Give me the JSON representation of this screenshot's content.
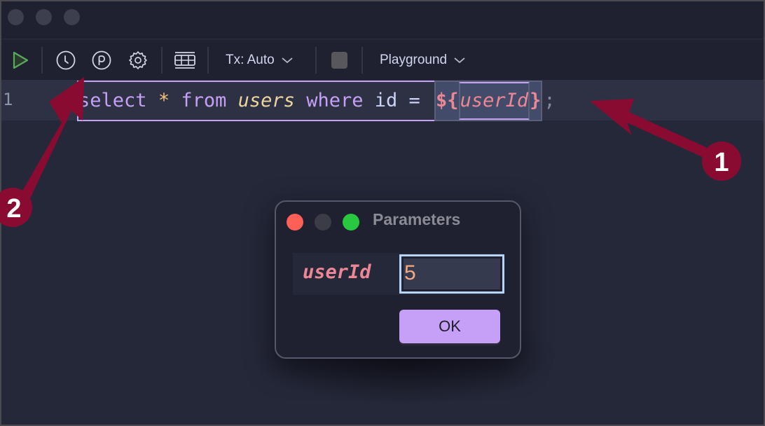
{
  "window": {
    "traffic_lights": [
      "close",
      "minimize",
      "maximize"
    ]
  },
  "toolbar": {
    "run_icon": "play-icon",
    "history_icon": "clock-icon",
    "parameters_icon": "p-circle-icon",
    "settings_icon": "gear-icon",
    "table_icon": "table-icon",
    "tx_mode_label": "Tx: Auto",
    "stop_icon": "stop-icon",
    "connection_label": "Playground"
  },
  "editor": {
    "line_number": "1",
    "tokens": {
      "kw_select": "select",
      "op_star": "*",
      "kw_from": "from",
      "table": "users",
      "kw_where": "where",
      "column": "id",
      "op_eq": "=",
      "ph_open": "${",
      "ph_name": "userId",
      "ph_close": "}",
      "semicolon": ";"
    }
  },
  "dialog": {
    "title": "Parameters",
    "param_label": "userId",
    "param_value": "5",
    "ok_label": "OK"
  },
  "annotations": {
    "badge_1": "1",
    "badge_2": "2",
    "color": "#8a0b32"
  }
}
